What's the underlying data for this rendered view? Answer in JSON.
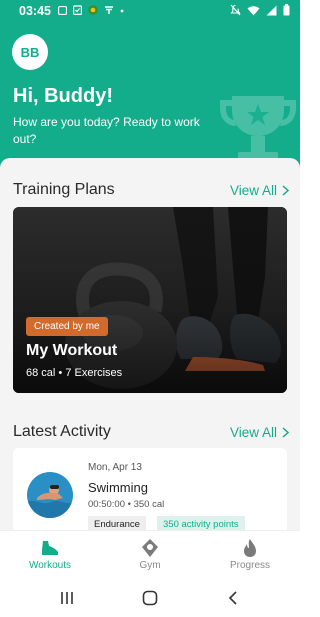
{
  "status_bar": {
    "time": "03:45",
    "left_icons": [
      "message-icon",
      "clipboard-icon",
      "app-badge-icon",
      "download-icon",
      "dot-icon"
    ],
    "right_icons": [
      "mute-icon",
      "wifi-icon",
      "signal-icon",
      "battery-icon"
    ]
  },
  "header": {
    "avatar_initials": "BB",
    "greeting": "Hi, Buddy!",
    "subtitle": "How are you today? Ready to work out?",
    "decoration_icon": "trophy-icon"
  },
  "training_plans": {
    "title": "Training Plans",
    "view_all": "View All",
    "card": {
      "badge": "Created by me",
      "name": "My Workout",
      "stats": "68 cal • 7 Exercises"
    }
  },
  "latest_activity": {
    "title": "Latest Activity",
    "view_all": "View All",
    "item": {
      "date": "Mon, Apr 13",
      "name": "Swimming",
      "meta": "00:50:00 • 350 cal",
      "tags": [
        "Endurance",
        "350 activity points"
      ]
    }
  },
  "bottom_nav": {
    "items": [
      {
        "label": "Workouts",
        "icon": "sneaker-icon",
        "active": true
      },
      {
        "label": "Gym",
        "icon": "location-pin-icon",
        "active": false
      },
      {
        "label": "Progress",
        "icon": "flame-icon",
        "active": false
      }
    ]
  },
  "system_nav": [
    "recents-icon",
    "home-icon",
    "back-icon"
  ],
  "colors": {
    "brand": "#14ad8c",
    "badge": "#d16a2a",
    "sheet_bg": "#f4f4f4"
  }
}
